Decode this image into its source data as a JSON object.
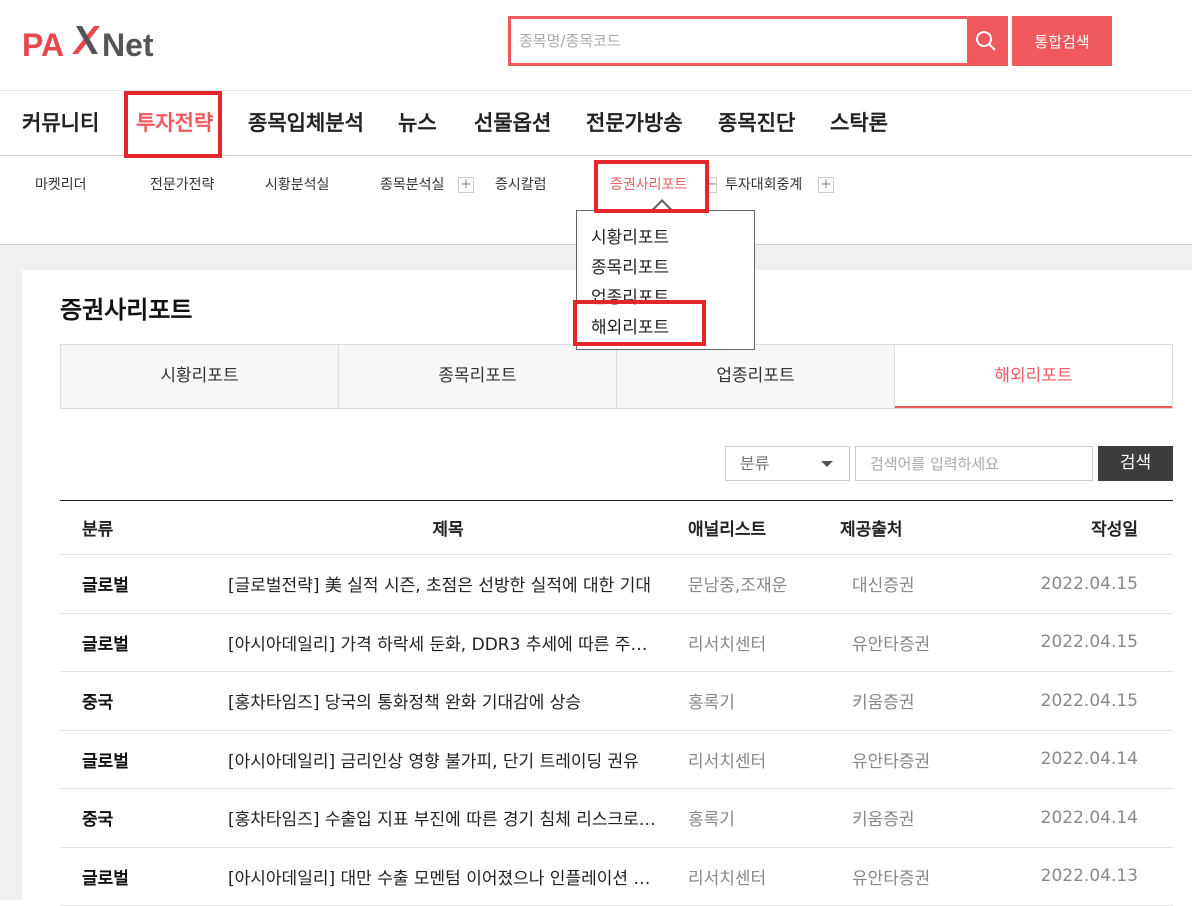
{
  "header": {
    "logo_text_left": "PA",
    "logo_text_right": "Net",
    "search_placeholder": "종목명/종목코드",
    "total_search_label": "통합검색"
  },
  "gnb": {
    "items": [
      "커뮤니티",
      "투자전략",
      "종목입체분석",
      "뉴스",
      "선물옵션",
      "전문가방송",
      "종목진단",
      "스탁론"
    ],
    "active": "투자전략"
  },
  "subnav": {
    "items": [
      "마켓리더",
      "전문가전략",
      "시황분석실",
      "종목분석실",
      "증시칼럼",
      "증권사리포트",
      "투자대회중계"
    ],
    "active": "증권사리포트"
  },
  "dropdown": {
    "items": [
      "시황리포트",
      "종목리포트",
      "업종리포트",
      "해외리포트"
    ],
    "highlighted": "해외리포트"
  },
  "page": {
    "title": "증권사리포트"
  },
  "tabs": {
    "items": [
      "시황리포트",
      "종목리포트",
      "업종리포트",
      "해외리포트"
    ],
    "active": "해외리포트"
  },
  "filter": {
    "select_value": "분류",
    "keyword_placeholder": "검색어를 입력하세요",
    "search_label": "검색"
  },
  "table": {
    "headers": {
      "category": "분류",
      "title": "제목",
      "analyst": "애널리스트",
      "source": "제공출처",
      "date": "작성일"
    },
    "rows": [
      {
        "category": "글로벌",
        "title": "[글로벌전략] 美 실적 시즌, 초점은 선방한 실적에 대한 기대",
        "analyst": "문남중,조재운",
        "source": "대신증권",
        "date": "2022.04.15"
      },
      {
        "category": "글로벌",
        "title": "[아시아데일리] 가격 하락세 둔화, DDR3 추세에 따른 주…",
        "analyst": "리서치센터",
        "source": "유안타증권",
        "date": "2022.04.15"
      },
      {
        "category": "중국",
        "title": "[홍차타임즈] 당국의 통화정책 완화 기대감에 상승",
        "analyst": "홍록기",
        "source": "키움증권",
        "date": "2022.04.15"
      },
      {
        "category": "글로벌",
        "title": "[아시아데일리] 금리인상 영향 불가피, 단기 트레이딩 권유",
        "analyst": "리서치센터",
        "source": "유안타증권",
        "date": "2022.04.14"
      },
      {
        "category": "중국",
        "title": "[홍차타임즈] 수출입 지표 부진에 따른 경기 침체 리스크로…",
        "analyst": "홍록기",
        "source": "키움증권",
        "date": "2022.04.14"
      },
      {
        "category": "글로벌",
        "title": "[아시아데일리] 대만 수출 모멘텀 이어졌으나 인플레이션 …",
        "analyst": "리서치센터",
        "source": "유안타증권",
        "date": "2022.04.13"
      }
    ]
  },
  "colors": {
    "accent": "#f05a5f",
    "highlight_box": "#e3262c",
    "dark_button": "#3d3d3d"
  }
}
